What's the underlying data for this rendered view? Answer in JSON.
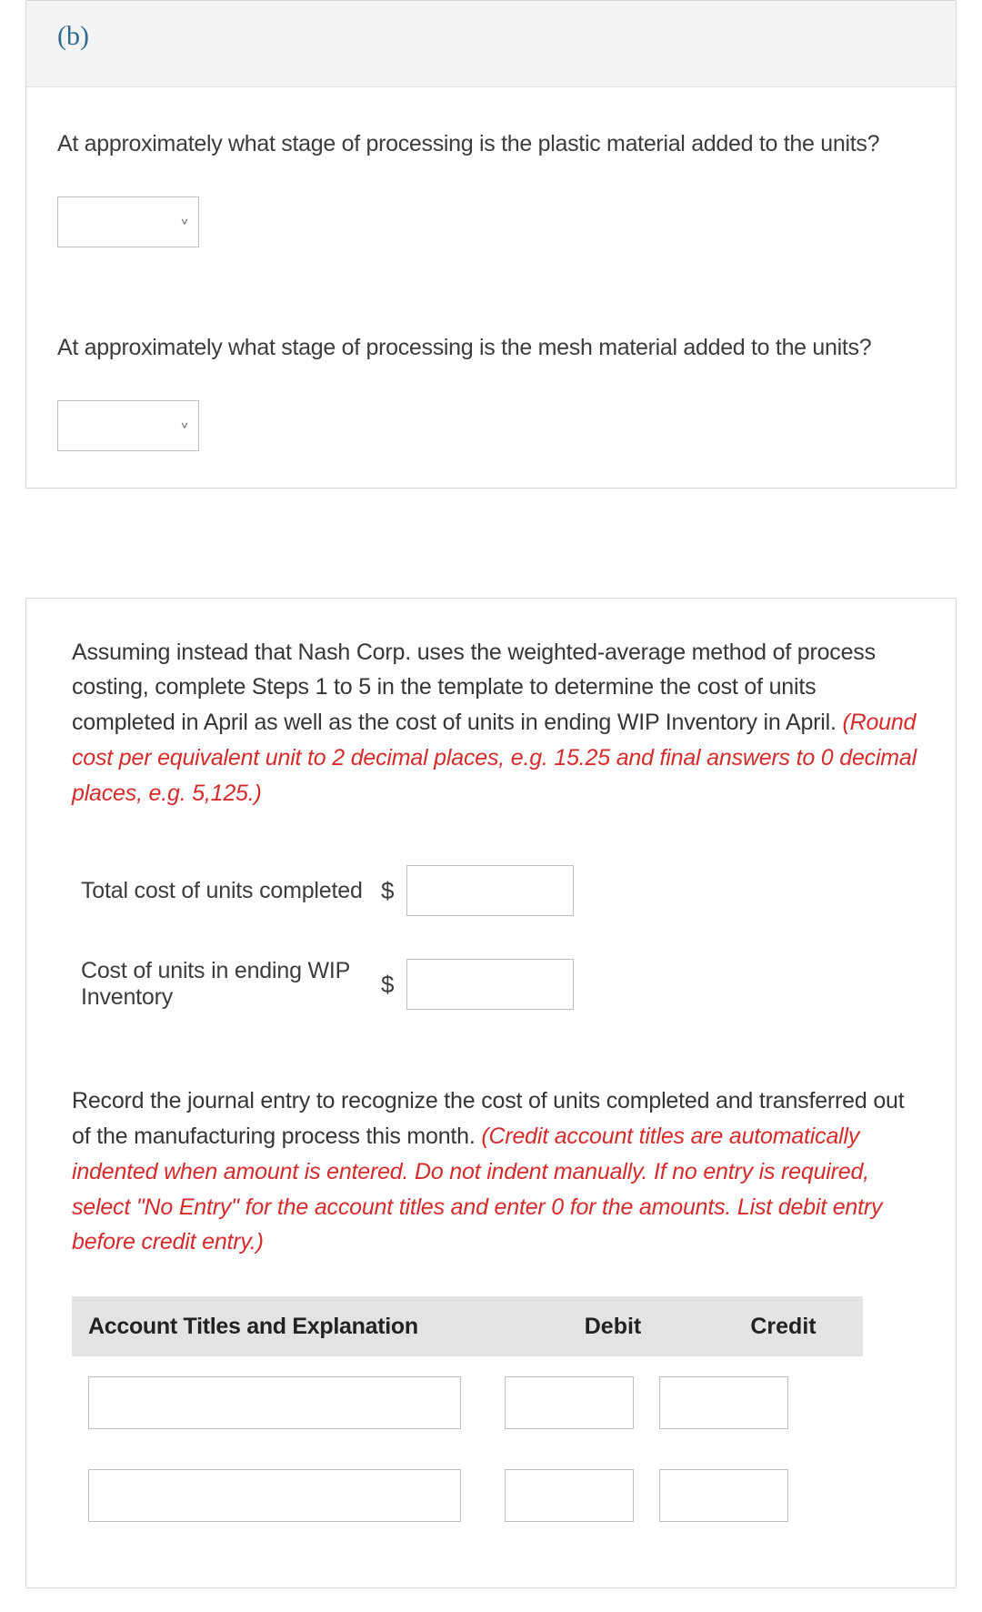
{
  "partB": {
    "label": "(b)",
    "q1": "At approximately what stage of processing is the plastic material added to the units?",
    "q2": "At approximately what stage of processing is the mesh material added to the units?"
  },
  "weighted": {
    "intro_plain": "Assuming instead that Nash Corp. uses the weighted-average method of process costing, complete Steps 1 to 5 in the template to determine the cost of units completed in April as well as the cost of units in ending WIP Inventory in April. ",
    "intro_red": "(Round cost per equivalent unit to 2 decimal places, e.g. 15.25 and final answers to 0 decimal places, e.g. 5,125.)",
    "rows": {
      "total_completed": "Total cost of units completed",
      "ending_wip": "Cost of units in ending WIP Inventory",
      "currency": "$"
    },
    "je_prompt_plain": "Record the journal entry to recognize the cost of units completed and transferred out of the manufacturing process this month. ",
    "je_prompt_red": "(Credit account titles are automatically indented when amount is entered. Do not indent manually. If no entry is required, select \"No Entry\" for the account titles and enter 0 for the amounts. List debit entry before credit entry.)",
    "table": {
      "col_account": "Account Titles and Explanation",
      "col_debit": "Debit",
      "col_credit": "Credit"
    }
  }
}
